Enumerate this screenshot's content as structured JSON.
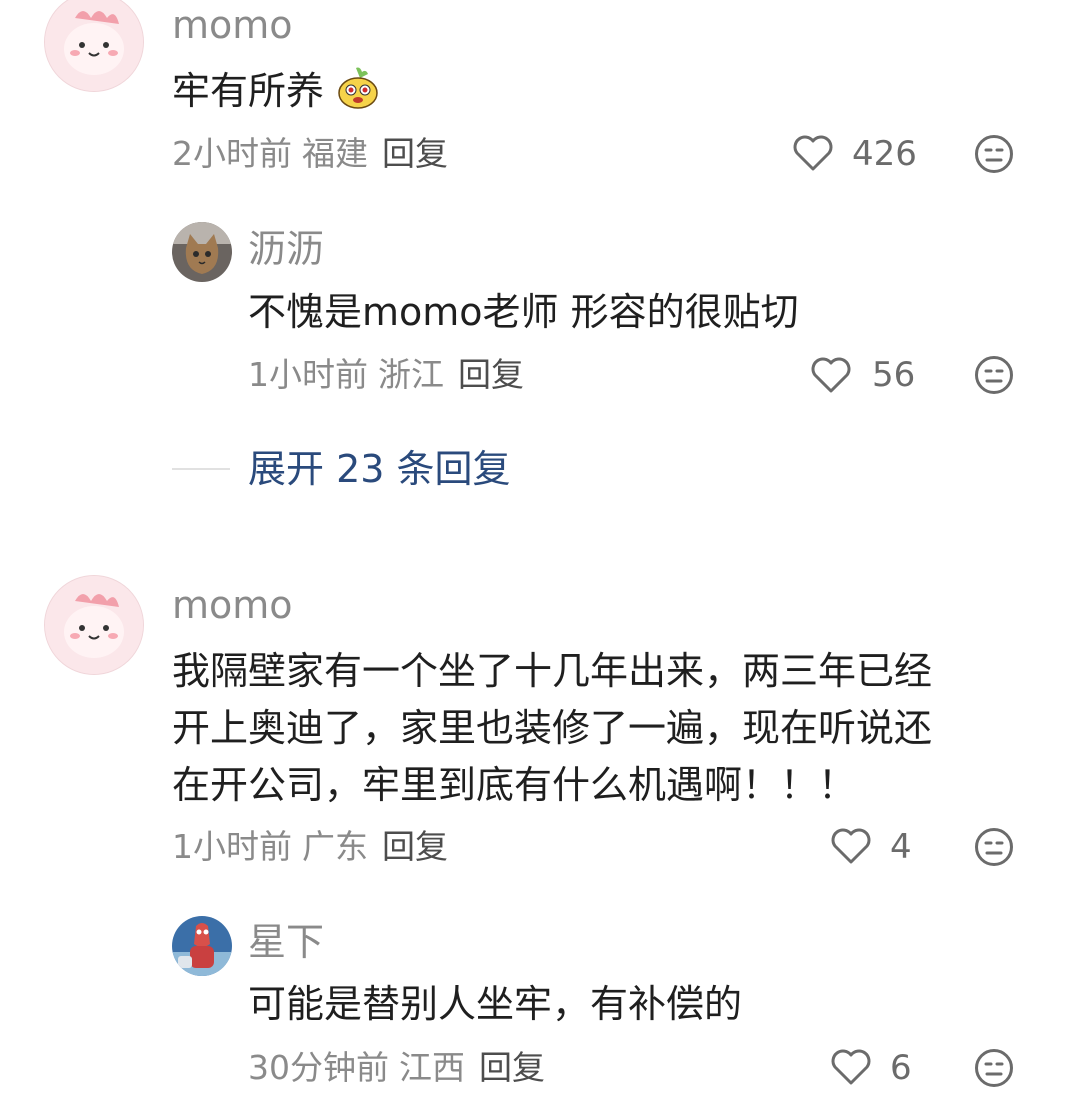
{
  "comments": [
    {
      "user": "momo",
      "text": "牢有所养",
      "has_emoji": true,
      "emoji_icon": "cartoon-fruit-face-sticker",
      "time": "2小时前",
      "location": "福建",
      "reply_label": "回复",
      "likes": "426",
      "replies": [
        {
          "user": "沥沥",
          "text": "不愧是momo老师 形容的很贴切",
          "time": "1小时前",
          "location": "浙江",
          "reply_label": "回复",
          "likes": "56"
        }
      ],
      "expand_label": "展开 23 条回复"
    },
    {
      "user": "momo",
      "text_lines": [
        "我隔壁家有一个坐了十几年出来，两三年已经",
        "开上奥迪了，家里也装修了一遍，现在听说还",
        "在开公司，牢里到底有什么机遇啊！！！"
      ],
      "time": "1小时前",
      "location": "广东",
      "reply_label": "回复",
      "likes": "4",
      "replies": [
        {
          "user": "星下",
          "text": "可能是替别人坐牢，有补偿的",
          "time": "30分钟前",
          "location": "江西",
          "reply_label": "回复",
          "likes": "6"
        }
      ]
    }
  ],
  "colors": {
    "link": "#2a4a7c",
    "meta": "#8a8a8a",
    "text": "#1f1f1f"
  }
}
